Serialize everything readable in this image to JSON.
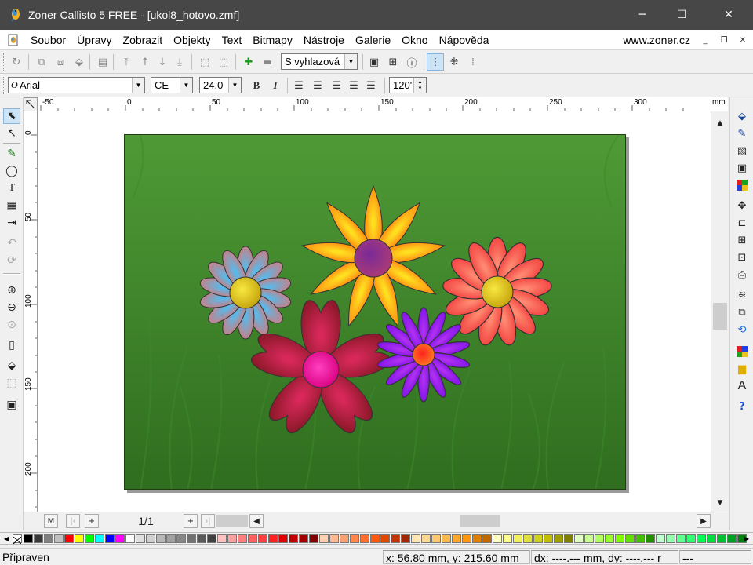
{
  "window": {
    "title": "Zoner Callisto 5 FREE - [ukol8_hotovo.zmf]",
    "minimize": "─",
    "maximize": "☐",
    "close": "✕"
  },
  "menu": {
    "items": [
      "Soubor",
      "Úpravy",
      "Zobrazit",
      "Objekty",
      "Text",
      "Bitmapy",
      "Nástroje",
      "Galerie",
      "Okno",
      "Nápověda"
    ],
    "url": "www.zoner.cz",
    "mdi_minimize": "_",
    "mdi_restore": "❐",
    "mdi_close": "✕"
  },
  "toolbar1": {
    "layer_combo": "S vyhlazová",
    "icons": [
      "redo-icon",
      "group-icon",
      "ungroup-icon",
      "combine-icon",
      "align-icon",
      "to-front-icon",
      "forward-icon",
      "backward-icon",
      "to-back-icon",
      "node-icon",
      "node-edit-icon",
      "add-node-icon",
      "delete-node-icon",
      "monitor-icon",
      "grid-icon",
      "info-icon",
      "snap-grid-icon",
      "snap-guides-icon",
      "snap-objects-icon"
    ]
  },
  "toolbar2": {
    "font_name": "Arial",
    "charset": "CE",
    "font_size": "24.0",
    "bold": "B",
    "italic": "I",
    "spacing": "120'"
  },
  "ruler": {
    "unit": "mm",
    "h_labels": [
      "-50",
      "0",
      "50",
      "100",
      "150",
      "200",
      "250",
      "300"
    ],
    "v_labels": [
      "0",
      "50",
      "100",
      "150",
      "200"
    ]
  },
  "pagination": {
    "label": "1/1",
    "first": "M",
    "prev": "|‹",
    "add_before": "+",
    "add_after": "+",
    "next": "›|"
  },
  "status": {
    "state": "Připraven",
    "position": "x: 56.80 mm, y: 215.60 mm",
    "delta": "dx: ----.--- mm, dy: ----.--- r",
    "extra": "---"
  },
  "colors": {
    "titlebar": "#474747",
    "grass_top": "#4f9a36",
    "grass_bottom": "#2d6b1e"
  },
  "palette": [
    "#000000",
    "#3a3a3a",
    "#808080",
    "#c0c0c0",
    "#ff0000",
    "#ffff00",
    "#00ff00",
    "#00ffff",
    "#0000ff",
    "#ff00ff",
    "#ffffff",
    "#e0e0e0",
    "#d0d0d0",
    "#b8b8b8",
    "#a0a0a0",
    "#888888",
    "#707070",
    "#585858",
    "#404040",
    "#ffc0c0",
    "#ffa0a0",
    "#ff8080",
    "#ff6060",
    "#ff4040",
    "#ff2020",
    "#e00000",
    "#c00000",
    "#a00000",
    "#800000",
    "#ffd0b0",
    "#ffb890",
    "#ffa070",
    "#ff8850",
    "#ff7030",
    "#ff5810",
    "#e04800",
    "#c03800",
    "#a02800",
    "#ffe8b0",
    "#ffd890",
    "#ffc870",
    "#ffb850",
    "#ffa830",
    "#ff9810",
    "#e08000",
    "#c06800",
    "#ffffc0",
    "#ffff90",
    "#f0f060",
    "#e0e040",
    "#d0d020",
    "#c0c000",
    "#a0a000",
    "#808000",
    "#e0ffc0",
    "#c8ff90",
    "#b0ff60",
    "#98ff30",
    "#80ff00",
    "#60e000",
    "#40c000",
    "#209000",
    "#c0ffd0",
    "#90ffb0",
    "#60ff90",
    "#30ff70",
    "#00ff50",
    "#00e040",
    "#00c030",
    "#00a020",
    "#008010"
  ]
}
